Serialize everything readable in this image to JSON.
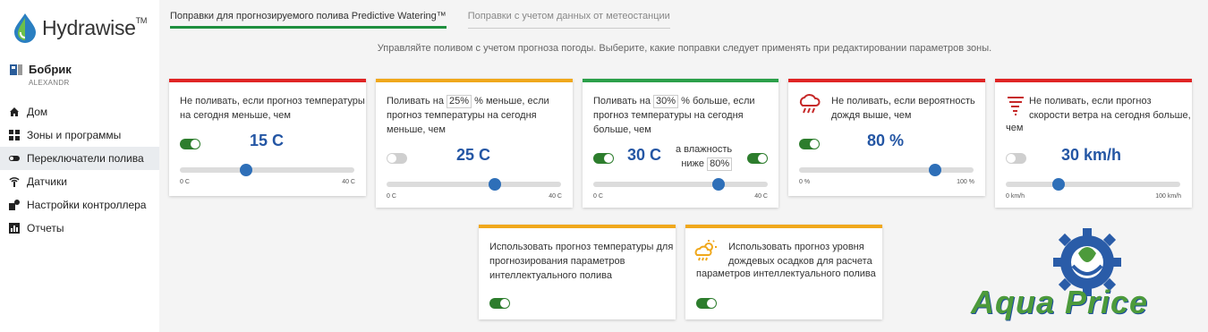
{
  "app": {
    "logo_text": "Hydrawise",
    "logo_tm": "TM"
  },
  "user": {
    "name": "Бобрик",
    "sub": "ALEXANDR"
  },
  "menu": [
    {
      "label": "Дом",
      "icon": "home-icon"
    },
    {
      "label": "Зоны и программы",
      "icon": "grid-icon"
    },
    {
      "label": "Переключатели полива",
      "icon": "toggle-icon",
      "active": true
    },
    {
      "label": "Датчики",
      "icon": "antenna-icon"
    },
    {
      "label": "Настройки контроллера",
      "icon": "controller-icon"
    },
    {
      "label": "Отчеты",
      "icon": "chart-icon"
    }
  ],
  "tabs": [
    {
      "label": "Поправки для прогнозируемого полива Predictive Watering™",
      "active": true
    },
    {
      "label": "Поправки с учетом данных от метеостанции",
      "active": false
    }
  ],
  "description": "Управляйте поливом с учетом прогноза погоды. Выберите, какие поправки следует применять при редактировании параметров зоны.",
  "cards": {
    "c1": {
      "text1": "Не поливать, если прогноз температуры",
      "text2": "на сегодня меньше, чем",
      "value": "15 C",
      "toggle_on": true,
      "slider_fraction": 0.38,
      "min": "0 C",
      "max": "40 C"
    },
    "c2": {
      "pre": "Поливать на ",
      "pct": "25%",
      "post": " % меньше, если",
      "text2": "прогноз температуры на сегодня",
      "text3": "меньше, чем",
      "value": "25 C",
      "toggle_on": false,
      "slider_fraction": 0.62,
      "min": "0 C",
      "max": "40 C"
    },
    "c3": {
      "pre": "Поливать на ",
      "pct": "30%",
      "post": " % больше, если",
      "text2": "прогноз температуры на сегодня",
      "text3": "больше, чем",
      "value": "30 C",
      "toggle_on": true,
      "hum_label1": "а влажность",
      "hum_label2": "ниже",
      "hum_value": "80%",
      "hum_toggle_on": true,
      "slider_fraction": 0.72,
      "min": "0 C",
      "max": "40 C"
    },
    "c4": {
      "text1": "Не поливать, если вероятность",
      "text2": "дождя выше, чем",
      "value": "80 %",
      "toggle_on": true,
      "slider_fraction": 0.78,
      "min": "0 %",
      "max": "100 %",
      "icon": "rain-cloud-icon"
    },
    "c5": {
      "text1": "Не поливать, если прогноз",
      "text2": "скорости ветра на сегодня больше,",
      "text3": "чем",
      "value": "30 km/h",
      "toggle_on": false,
      "slider_fraction": 0.3,
      "min": "0 km/h",
      "max": "100 km/h",
      "icon": "tornado-icon"
    },
    "c6": {
      "text1": "Использовать прогноз температуры для",
      "text2": "прогнозирования параметров",
      "text3": "интеллектуального полива",
      "toggle_on": true
    },
    "c7": {
      "text1": "Использовать прогноз уровня",
      "text2": "дождевых осадков для расчета",
      "text3": "параметров интеллектуального полива",
      "toggle_on": true,
      "icon": "sun-rain-icon"
    }
  },
  "watermark": {
    "text": "Aqua Price"
  },
  "colors": {
    "accent": "#1e8f3e",
    "value": "#2456a4",
    "red": "#e02424",
    "orange": "#f0a81c",
    "green": "#2ba04a",
    "toggle_on": "#2d7d2d",
    "thumb": "#2e6fb8"
  }
}
